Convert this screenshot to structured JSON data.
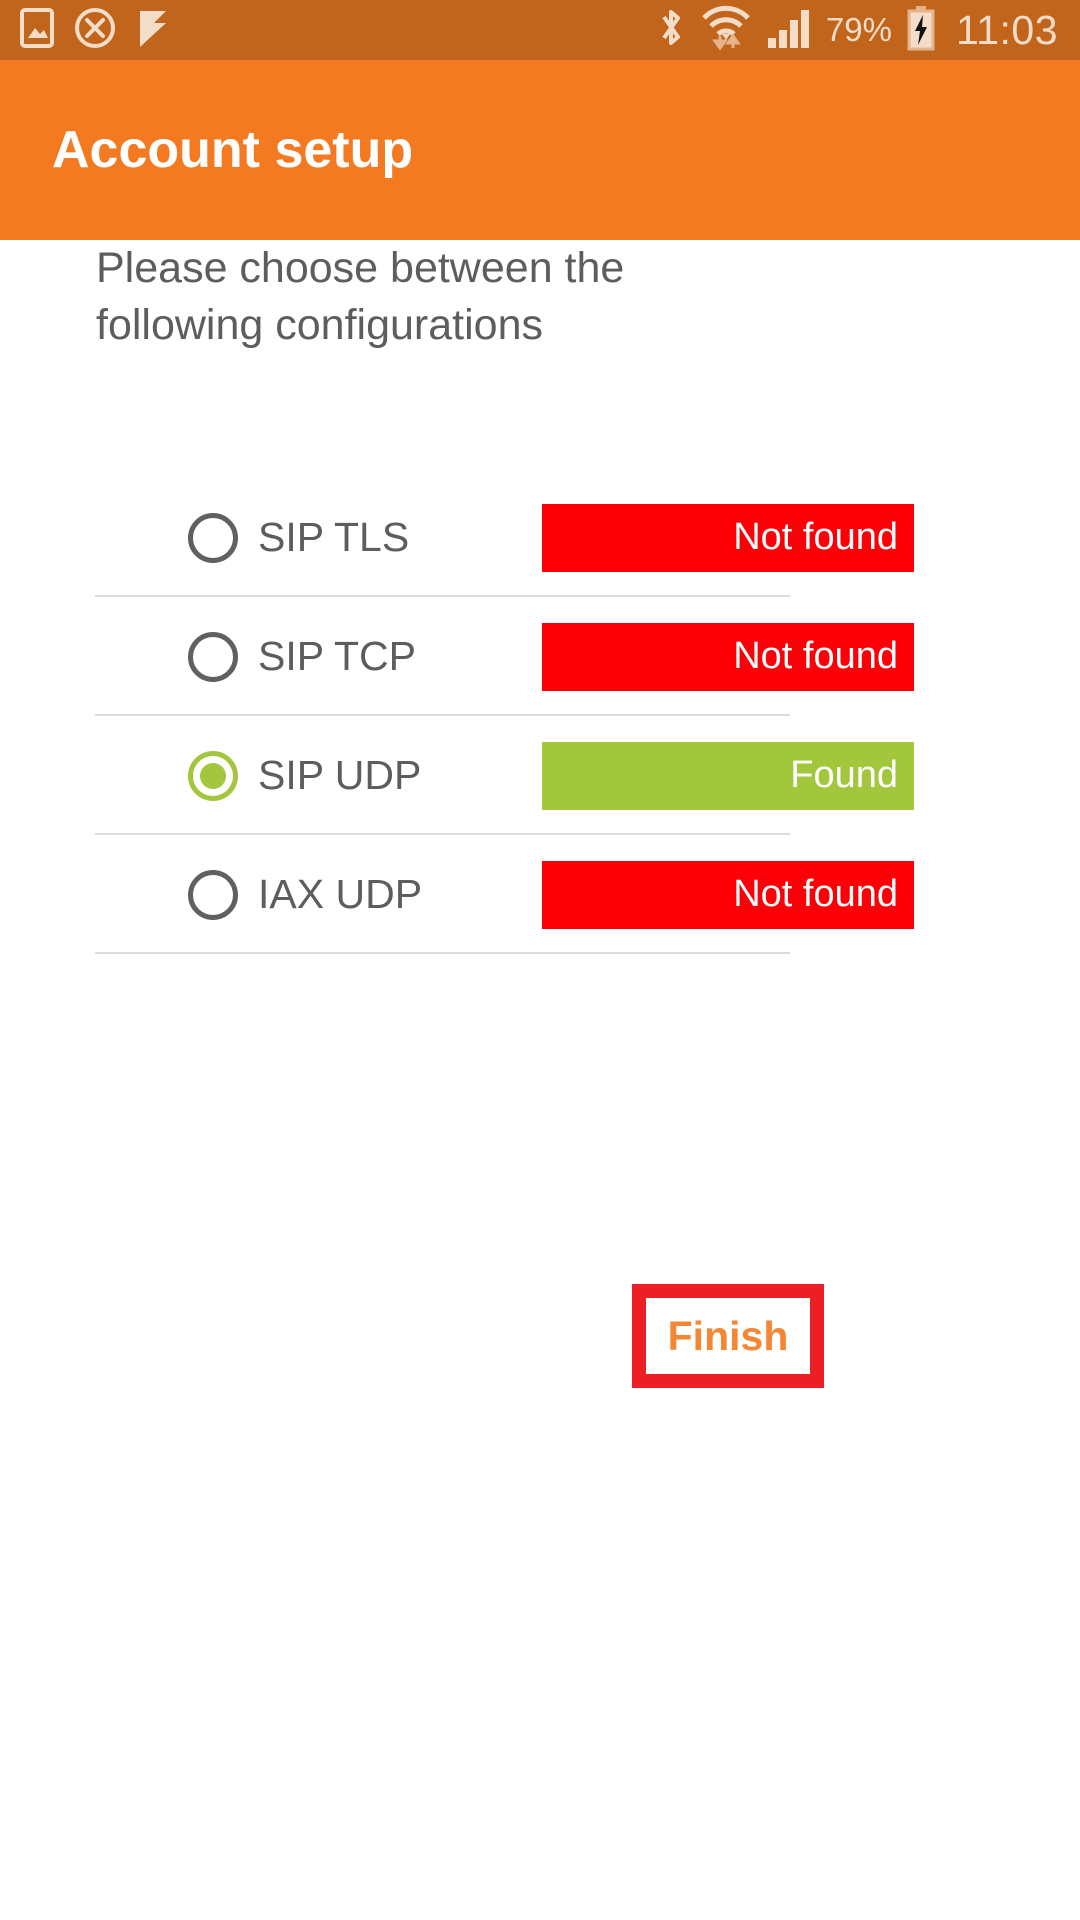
{
  "status_bar": {
    "background": "#c1651c",
    "foreground": "#f3dcc8",
    "left_icons": [
      {
        "name": "screenshot-image-icon",
        "glyph": "image"
      },
      {
        "name": "cancel-circle-icon",
        "glyph": "circle-x"
      },
      {
        "name": "flag-check-icon",
        "glyph": "flag-check"
      }
    ],
    "right_icons": [
      {
        "name": "bluetooth-icon",
        "glyph": "bluetooth"
      },
      {
        "name": "wifi-data-icon",
        "glyph": "wifi-arrows"
      },
      {
        "name": "cellular-signal-icon",
        "glyph": "signal-bars"
      }
    ],
    "battery_percent": "79%",
    "battery_icon": "battery-charging-icon",
    "clock": "11:03"
  },
  "action_bar": {
    "title": "Account setup",
    "background": "#f37a21",
    "title_color": "#ffffff"
  },
  "main": {
    "instruction": "Please choose between the following configurations",
    "configurations": [
      {
        "label": "SIP TLS",
        "selected": false,
        "status": "Not found",
        "status_type": "notfound",
        "status_color": "#fb0007"
      },
      {
        "label": "SIP TCP",
        "selected": false,
        "status": "Not found",
        "status_type": "notfound",
        "status_color": "#fb0007"
      },
      {
        "label": "SIP UDP",
        "selected": true,
        "status": "Found",
        "status_type": "found",
        "status_color": "#a2c63c"
      },
      {
        "label": "IAX UDP",
        "selected": false,
        "status": "Not found",
        "status_type": "notfound",
        "status_color": "#fb0007"
      }
    ]
  },
  "footer": {
    "finish_label": "Finish",
    "finish_text_color": "#f58634",
    "finish_highlight_color": "#ec2024"
  }
}
